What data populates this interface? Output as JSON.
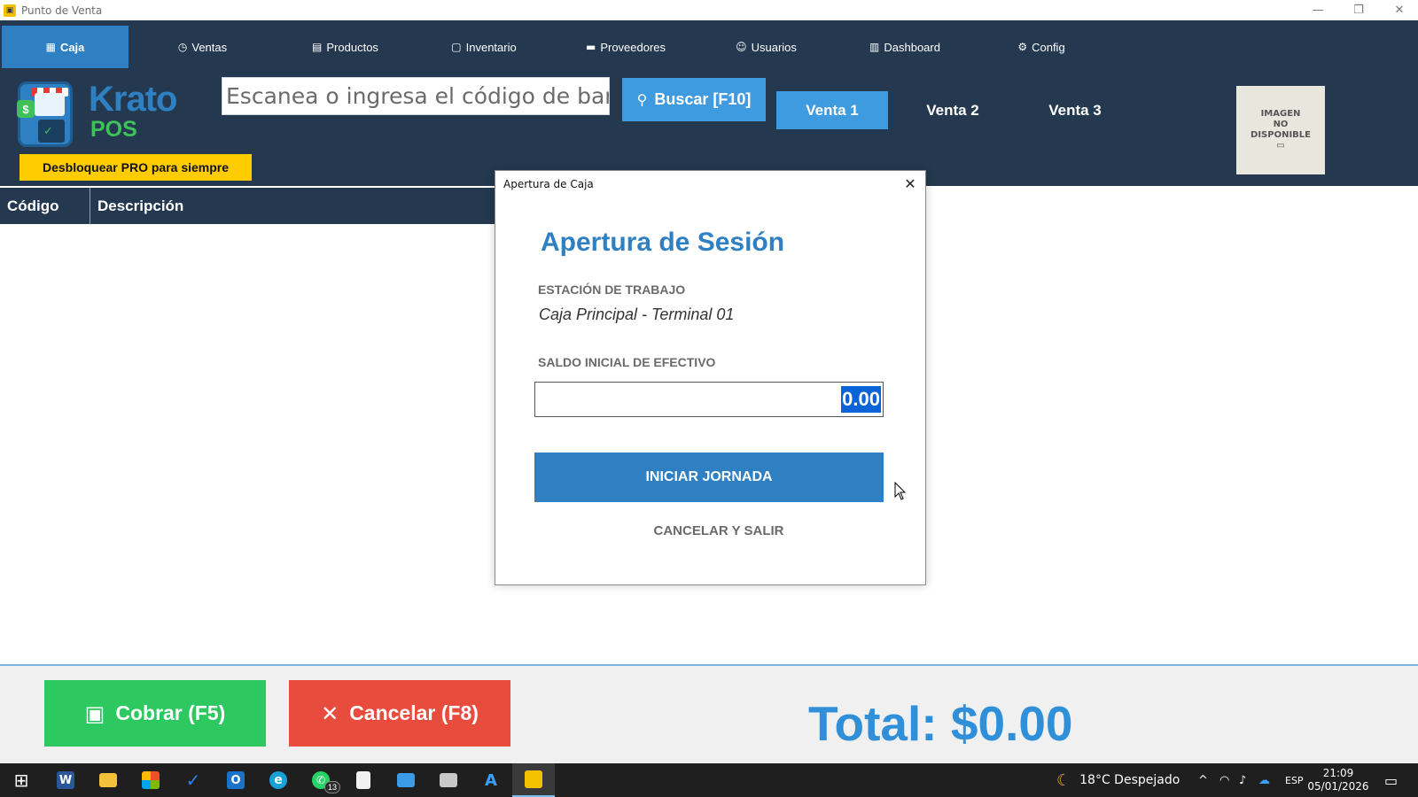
{
  "window": {
    "title": "Punto de Venta",
    "minimize": "—",
    "restore": "❐",
    "close": "✕"
  },
  "nav": {
    "tabs": [
      {
        "label": "Caja",
        "icon": "cash-register-icon",
        "glyph": "▦"
      },
      {
        "label": "Ventas",
        "icon": "stopwatch-icon",
        "glyph": "◷"
      },
      {
        "label": "Productos",
        "icon": "box-icon",
        "glyph": "▤"
      },
      {
        "label": "Inventario",
        "icon": "clipboard-icon",
        "glyph": "▢"
      },
      {
        "label": "Proveedores",
        "icon": "truck-icon",
        "glyph": "▬"
      },
      {
        "label": "Usuarios",
        "icon": "users-icon",
        "glyph": "☺"
      },
      {
        "label": "Dashboard",
        "icon": "bar-chart-icon",
        "glyph": "▥"
      },
      {
        "label": "Config",
        "icon": "gear-icon",
        "glyph": "⚙"
      }
    ]
  },
  "brand": {
    "word1": "Krato",
    "word2": "POS",
    "dollar": "$",
    "check": "✓"
  },
  "unlock_label": "Desbloquear PRO para siempre",
  "search": {
    "placeholder": "Escanea o ingresa el código de bar...",
    "button_label": "Buscar [F10]",
    "button_glyph": "⚲"
  },
  "sales": [
    "Venta 1",
    "Venta 2",
    "Venta 3"
  ],
  "product_image": {
    "line1": "IMAGEN",
    "line2": "NO",
    "line3": "DISPONIBLE",
    "line4": "▭"
  },
  "grid": {
    "columns": [
      "Código",
      "Descripción"
    ]
  },
  "bottom": {
    "cobrar_label": "Cobrar (F5)",
    "cobrar_glyph": "▣",
    "cancelar_label": "Cancelar (F8)",
    "cancelar_glyph": "✕",
    "total": "Total: $0.00"
  },
  "dialog": {
    "title": "Apertura de Caja",
    "close": "✕",
    "heading": "Apertura de Sesión",
    "station_label": "ESTACIÓN DE TRABAJO",
    "station_value": "Caja Principal - Terminal 01",
    "cash_label": "SALDO INICIAL DE EFECTIVO",
    "cash_value": "0.00",
    "start_button": "INICIAR JORNADA",
    "cancel_button": "CANCELAR Y SALIR"
  },
  "taskbar": {
    "start_glyph": "⊞",
    "apps": [
      {
        "name": "word-icon",
        "color": "#2b579a",
        "glyph": "W"
      },
      {
        "name": "file-explorer-icon",
        "color": "#f3c13a",
        "glyph": ""
      },
      {
        "name": "store-icon",
        "color": "#ffffff",
        "glyph": ""
      },
      {
        "name": "todo-icon",
        "color": "#2f80ed",
        "glyph": "✓"
      },
      {
        "name": "outlook-icon",
        "color": "#1a73c8",
        "glyph": "O"
      },
      {
        "name": "edge-icon",
        "color": "#1aa0d8",
        "glyph": "e"
      },
      {
        "name": "whatsapp-icon",
        "color": "#25d366",
        "glyph": "✆"
      },
      {
        "name": "notepad-icon",
        "color": "#f2f2f2",
        "glyph": ""
      },
      {
        "name": "remote-desktop-icon",
        "color": "#3d9be6",
        "glyph": ""
      },
      {
        "name": "photos-icon",
        "color": "#c8c8c8",
        "glyph": ""
      },
      {
        "name": "azure-icon",
        "color": "#1f1f1f",
        "glyph": "A"
      },
      {
        "name": "punto-de-venta-icon",
        "color": "#f2c200",
        "glyph": ""
      }
    ],
    "whatsapp_badge": "13",
    "weather": {
      "glyph": "☾",
      "text": "18°C  Despejado"
    },
    "tray": {
      "chevron": "^",
      "wifi": "◠",
      "volume": "♪",
      "cloud": "☁",
      "language": "ESP"
    },
    "time": "21:09",
    "date": "05/01/2026",
    "notification_glyph": "▭"
  }
}
